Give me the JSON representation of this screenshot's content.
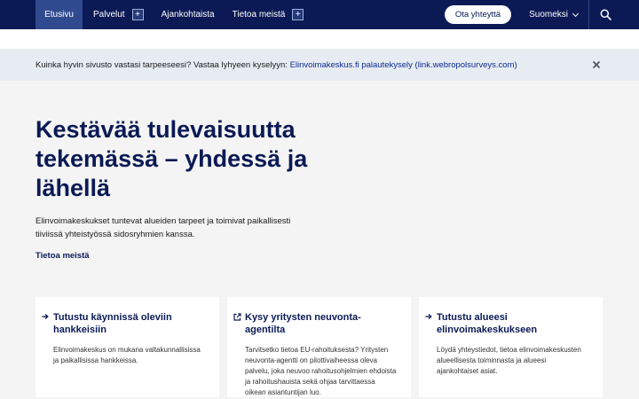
{
  "nav": {
    "items": [
      {
        "label": "Etusivu",
        "active": true,
        "has_plus": false
      },
      {
        "label": "Palvelut",
        "active": false,
        "has_plus": true
      },
      {
        "label": "Ajankohtaista",
        "active": false,
        "has_plus": false
      },
      {
        "label": "Tietoa meistä",
        "active": false,
        "has_plus": true
      }
    ],
    "plus_symbol": "+",
    "contact_label": "Ota yhteyttä",
    "language_label": "Suomeksi",
    "search_icon": "search-icon"
  },
  "banner": {
    "text": "Kuinka hyvin sivusto vastasi tarpeeseesi? Vastaa lyhyeen kyselyyn: ",
    "link_text": "Elinvoimakeskus.fi palautekysely (link.webropolsurveys.com)",
    "close_icon": "close-icon"
  },
  "hero": {
    "title": "Kestävää tulevaisuutta tekemässä – yhdessä ja lähellä",
    "description": "Elinvoimakeskukset tuntevat alueiden tarpeet ja toimivat paikallisesti tiiviissä yhteistyössä sidosryhmien kanssa.",
    "link_label": "Tietoa meistä"
  },
  "cards": [
    {
      "title": "Tutustu käynnissä oleviin hankkeisiin",
      "text": "Elinvoimakeskus on mukana valtakunnallisissa ja paikallisissa hankkeissa.",
      "icon": "arrow-right-icon"
    },
    {
      "title": "Kysy yritysten neuvonta-agentilta",
      "text": "Tarvitsetko tietoa EU-rahoituksesta? Yritysten neuvonta-agentti on pilottivaiheessa oleva palvelu, joka neuvoo rahoitusohjelmien ehdoista ja rahoitushauista sekä ohjaa tarvittaessa oikean asiantuntijan luo.",
      "icon": "external-link-icon"
    },
    {
      "title": "Tutustu alueesi elinvoimakeskukseen",
      "text": "Löydä yhteystiedot, tietoa elinvoimakeskusten alueellisesta toiminnasta ja alueesi ajankohtaiset asiat.",
      "icon": "arrow-right-icon"
    }
  ],
  "colors": {
    "nav_bg": "#0b1a55",
    "nav_active": "#2f4a8f",
    "banner_bg": "#e7ecf3",
    "page_bg": "#f4f4f4",
    "heading": "#0b1a55"
  }
}
